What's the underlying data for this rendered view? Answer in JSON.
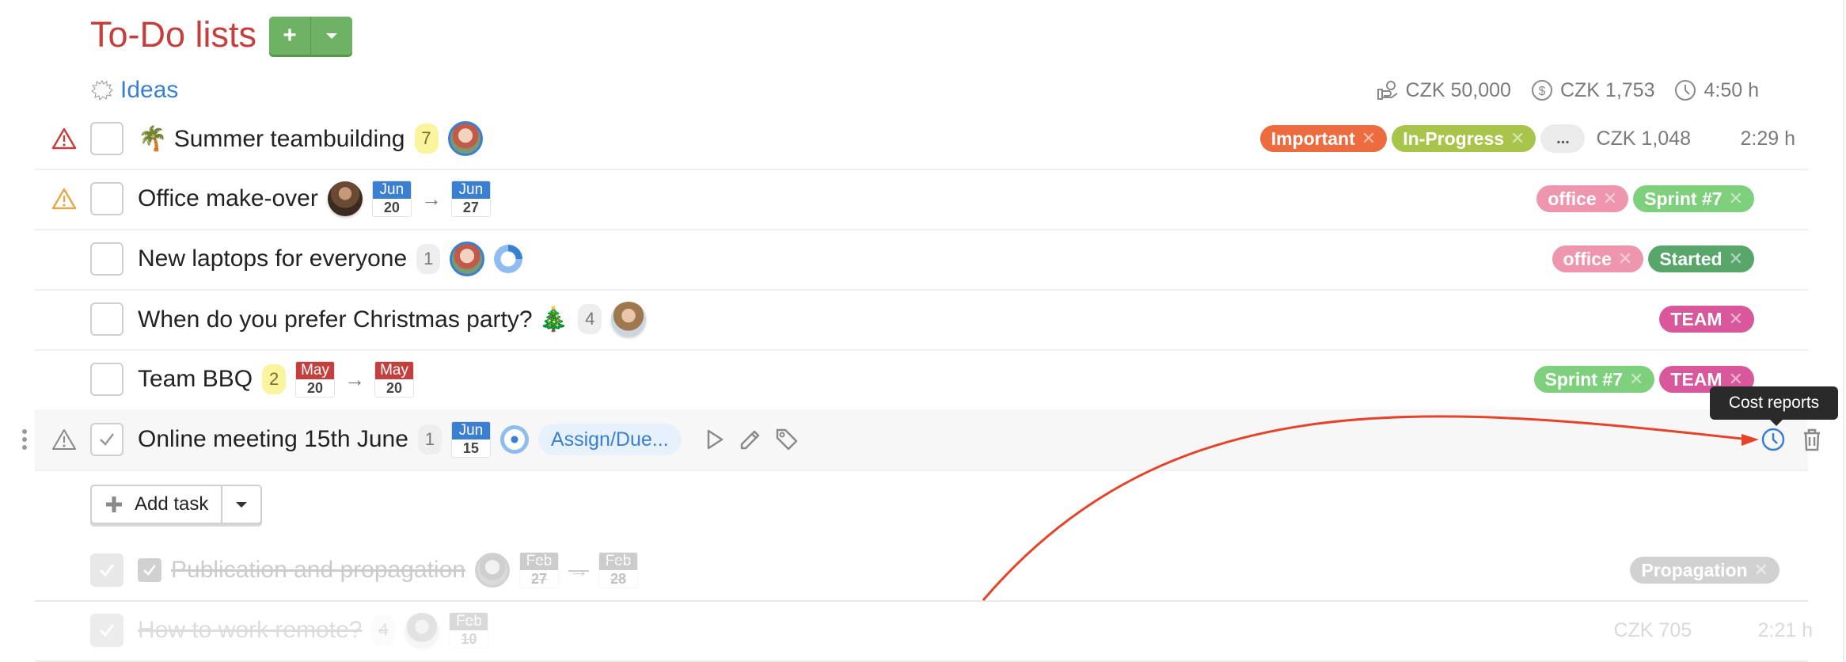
{
  "header": {
    "title": "To-Do lists",
    "add_list_icon": "plus-icon",
    "add_list_menu_icon": "caret-down-icon"
  },
  "list": {
    "name": "Ideas",
    "icon": "thought-bubble-icon",
    "totals": {
      "budget": "CZK 50,000",
      "cost": "CZK 1,753",
      "time": "4:50 h"
    }
  },
  "tasks": [
    {
      "title": "🌴 Summer teambuilding",
      "priority": "high",
      "priority_color": "#c4403f",
      "comments": "7",
      "tags": [
        {
          "label": "Important",
          "color": "#ec6c3f"
        },
        {
          "label": "In-Progress",
          "color": "#a9c44a"
        }
      ],
      "more_label": "...",
      "cost": "CZK 1,048",
      "time": "2:29 h"
    },
    {
      "title": "Office make-over",
      "priority": "medium",
      "priority_color": "#e7a84a",
      "start": {
        "month": "Jun",
        "day": "20"
      },
      "due": {
        "month": "Jun",
        "day": "27"
      },
      "tags": [
        {
          "label": "office",
          "color": "#ee96ad"
        },
        {
          "label": "Sprint #7",
          "color": "#7fd07c"
        }
      ]
    },
    {
      "title": "New laptops for everyone",
      "comments": "1",
      "progress": 0.25,
      "tags": [
        {
          "label": "office",
          "color": "#ee96ad"
        },
        {
          "label": "Started",
          "color": "#58a66a"
        }
      ]
    },
    {
      "title": "When do you prefer Christmas party? 🎄",
      "comments": "4",
      "tags": [
        {
          "label": "TEAM",
          "color": "#d9579b"
        }
      ]
    },
    {
      "title": "Team BBQ",
      "comments": "2",
      "start": {
        "month": "May",
        "day": "20"
      },
      "due": {
        "month": "May",
        "day": "20"
      },
      "tags": [
        {
          "label": "Sprint #7",
          "color": "#7fd07c"
        },
        {
          "label": "TEAM",
          "color": "#d9579b"
        }
      ]
    },
    {
      "title": "Online meeting 15th June",
      "comments": "1",
      "due": {
        "month": "Jun",
        "day": "15"
      },
      "assign_label": "Assign/Due...",
      "tools": [
        "play-icon",
        "pencil-icon",
        "tag-icon"
      ],
      "right_tools": [
        "clock-icon",
        "trash-icon"
      ],
      "tooltip": "Cost reports"
    }
  ],
  "add_task": {
    "label": "Add task"
  },
  "completed": [
    {
      "title": "Publication and propagation",
      "start": {
        "month": "Feb",
        "day": "27"
      },
      "due": {
        "month": "Feb",
        "day": "28"
      },
      "tags": [
        {
          "label": "Propagation",
          "color": "#9a9a9a"
        }
      ]
    },
    {
      "title": "How to work remote?",
      "comments": "4",
      "due": {
        "month": "Feb",
        "day": "10"
      },
      "cost": "CZK 705",
      "time": "2:21 h"
    }
  ],
  "colors": {
    "title": "#c4403f",
    "accent": "#3a7fd2",
    "add_button": "#6db363",
    "annotation_arrow": "#e5442b"
  }
}
